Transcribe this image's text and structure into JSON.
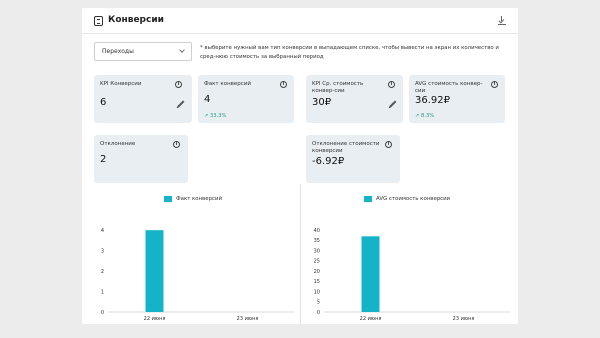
{
  "header": {
    "title": "Конверсии",
    "icon": "report-icon",
    "download_icon": "download-icon"
  },
  "filter": {
    "selected": "Переходы",
    "hint": "* выберите нужный вам тип конверсии в выпадающем списке, чтобы вывести на экран их количество и сред-нюю стоимость за выбранный период"
  },
  "cards": {
    "kpi_conversions": {
      "label": "KPI Конверсии",
      "value": "6"
    },
    "fact_conversions": {
      "label": "Факт конверсий",
      "value": "4",
      "delta": "↗ 33.3%"
    },
    "kpi_cost": {
      "label": "KPI Ср. стоимость конвер-сии",
      "value": "30₽"
    },
    "avg_cost": {
      "label": "AVG стоимость конвер-сии",
      "value": "36.92₽",
      "delta": "↗ 8.3%"
    },
    "deviation": {
      "label": "Отклонение",
      "value": "2"
    },
    "cost_deviation": {
      "label": "Отклонение стоимости конверсии",
      "value": "-6.92₽"
    }
  },
  "colors": {
    "accent": "#15b3c8",
    "card_bg": "#e8eef2",
    "positive": "#2a9d8f"
  },
  "chart_data": [
    {
      "type": "bar",
      "legend": "Факт конверсий",
      "categories": [
        "22 июня",
        "23 июня"
      ],
      "series": [
        {
          "name": "Факт конверсий",
          "values": [
            4,
            0
          ]
        }
      ],
      "yticks": [
        "0",
        "1",
        "2",
        "3",
        "4"
      ],
      "ylim": [
        0,
        4.4
      ],
      "color": "#15b3c8"
    },
    {
      "type": "bar",
      "legend": "AVG стоимость конверсии",
      "categories": [
        "22 июня",
        "23 июня"
      ],
      "series": [
        {
          "name": "AVG стоимость конверсии",
          "values": [
            36.92,
            0
          ]
        }
      ],
      "yticks": [
        "0",
        "5",
        "10",
        "15",
        "20",
        "25",
        "30",
        "35",
        "40"
      ],
      "ylim": [
        0,
        40
      ],
      "color": "#15b3c8"
    }
  ]
}
